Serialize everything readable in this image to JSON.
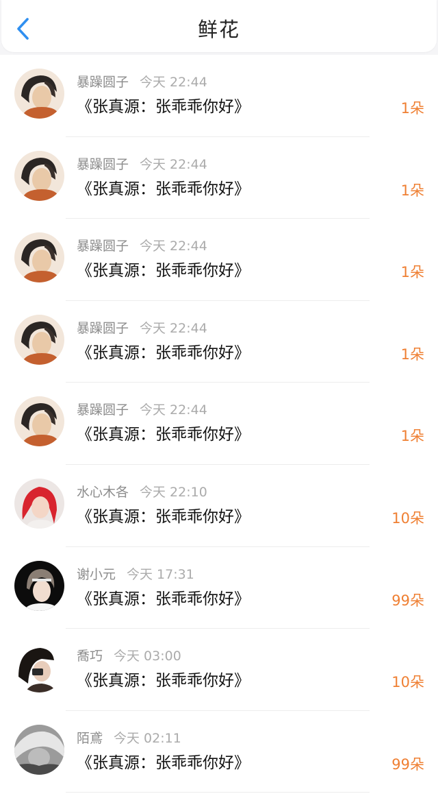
{
  "header": {
    "title": "鲜花"
  },
  "items": [
    {
      "name": "暴躁圆子",
      "time": "今天 22:44",
      "gift": "《张真源：张乖乖你好》",
      "count": "1朵",
      "avatar": "avatar-1"
    },
    {
      "name": "暴躁圆子",
      "time": "今天 22:44",
      "gift": "《张真源：张乖乖你好》",
      "count": "1朵",
      "avatar": "avatar-1"
    },
    {
      "name": "暴躁圆子",
      "time": "今天 22:44",
      "gift": "《张真源：张乖乖你好》",
      "count": "1朵",
      "avatar": "avatar-1"
    },
    {
      "name": "暴躁圆子",
      "time": "今天 22:44",
      "gift": "《张真源：张乖乖你好》",
      "count": "1朵",
      "avatar": "avatar-1"
    },
    {
      "name": "暴躁圆子",
      "time": "今天 22:44",
      "gift": "《张真源：张乖乖你好》",
      "count": "1朵",
      "avatar": "avatar-1"
    },
    {
      "name": "水心木各",
      "time": "今天 22:10",
      "gift": "《张真源：张乖乖你好》",
      "count": "10朵",
      "avatar": "avatar-2"
    },
    {
      "name": "谢小元",
      "time": "今天 17:31",
      "gift": "《张真源：张乖乖你好》",
      "count": "99朵",
      "avatar": "avatar-3"
    },
    {
      "name": "喬巧",
      "time": "今天 03:00",
      "gift": "《张真源：张乖乖你好》",
      "count": "10朵",
      "avatar": "avatar-4"
    },
    {
      "name": "陌鳶",
      "time": "今天 02:11",
      "gift": "《张真源：张乖乖你好》",
      "count": "99朵",
      "avatar": "avatar-5"
    }
  ],
  "colors": {
    "accent": "#ef7f32",
    "back_arrow": "#2f8ff0",
    "name_text": "#8c8c8c",
    "time_text": "#ababab",
    "gift_text": "#111111"
  },
  "icons": {
    "back": "chevron-left-icon"
  }
}
